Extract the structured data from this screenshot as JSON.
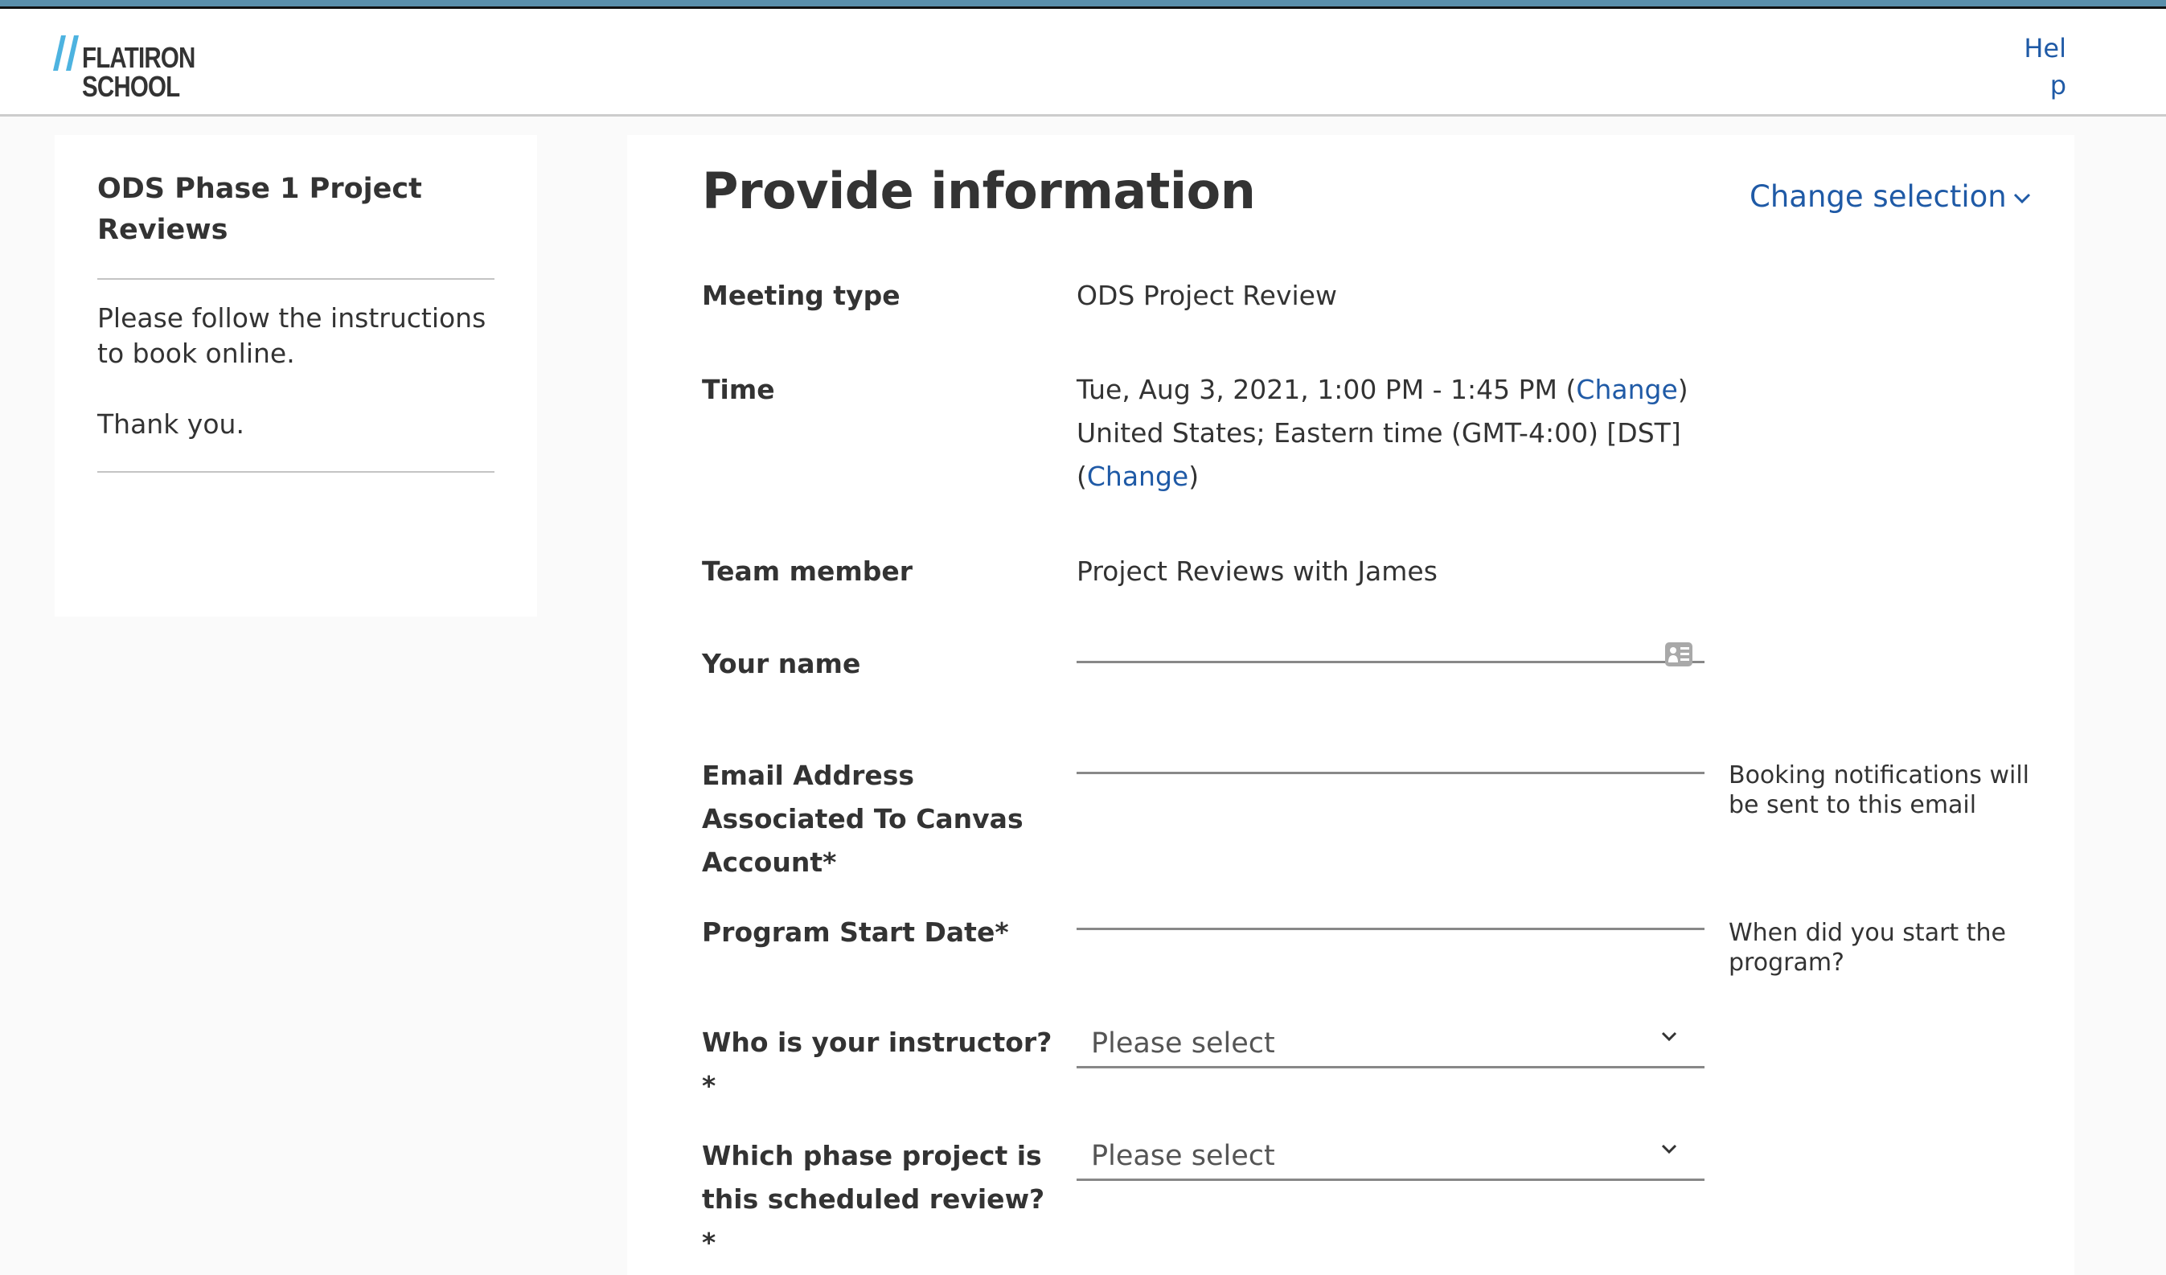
{
  "header": {
    "logo_line1": "FLATIRON",
    "logo_line2": "SCHOOL",
    "logo_accent_color": "#4db3e0",
    "help_link": "Help",
    "top_stripe_color": "#5a8fab"
  },
  "sidebar": {
    "title": "ODS Phase 1 Project Reviews",
    "instructions": "Please follow the instructions to book online.",
    "closing": "Thank you."
  },
  "main": {
    "title": "Provide information",
    "change_selection": "Change selection",
    "link_color": "#1f5aa6",
    "details": {
      "meeting_type_label": "Meeting type",
      "meeting_type_value": "ODS Project Review",
      "time_label": "Time",
      "time_value": "Tue, Aug 3, 2021, 1:00 PM - 1:45 PM (",
      "time_change": "Change",
      "time_close": ")",
      "timezone_value": "United States; Eastern time (GMT-4:00) [DST]",
      "timezone_open": "(",
      "timezone_change": "Change",
      "timezone_close": ")",
      "team_member_label": "Team member",
      "team_member_value": "Project Reviews with James"
    },
    "form": {
      "name_label": "Your name",
      "name_value": "",
      "email_label": "Email Address Associated To Canvas Account*",
      "email_value": "",
      "email_helper": "Booking notifications will be sent to this email",
      "start_date_label": "Program Start Date*",
      "start_date_value": "",
      "start_date_helper": "When did you start the program?",
      "instructor_label": "Who is your instructor?*",
      "instructor_selected": "Please select",
      "phase_label": "Which phase project is this scheduled review?*",
      "phase_selected": "Please select"
    }
  }
}
